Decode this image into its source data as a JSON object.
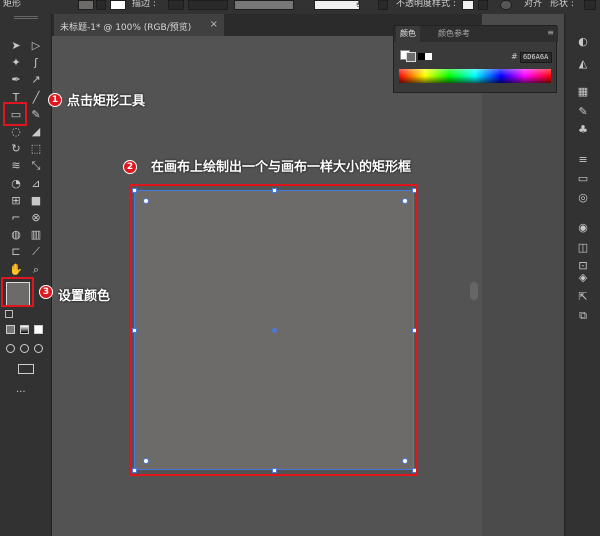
{
  "app": {
    "corner_label": "矩形"
  },
  "control_bar": {
    "stroke_label": "描边 :",
    "profile_label": "基本",
    "opacity_label": "不透明度",
    "style_label": "样式 :",
    "align_label": "对齐",
    "shape_label": "形状 :"
  },
  "document": {
    "tab_title": "未标题-1* @ 100% (RGB/预览)",
    "close": "×"
  },
  "color_panel": {
    "tab_color": "颜色",
    "tab_guide": "颜色参考",
    "hex_symbol": "#",
    "hex_value": "6D6A6A",
    "fill_hex": "#6d6a6a"
  },
  "annotations": {
    "step1": {
      "number": "1",
      "text": "点击矩形工具"
    },
    "step2": {
      "number": "2",
      "text": "在画布上绘制出一个与画布一样大小的矩形框"
    },
    "step3": {
      "number": "3",
      "text": "设置颜色"
    }
  },
  "toolbar": {
    "tools": [
      "selection-tool",
      "direct-selection-tool",
      "magic-wand-tool",
      "lasso-tool",
      "pen-tool",
      "curvature-tool",
      "type-tool",
      "line-tool",
      "rectangle-tool",
      "paintbrush-tool",
      "shaper-tool",
      "eraser-tool",
      "rotate-tool",
      "scale-tool",
      "width-tool",
      "free-transform-tool",
      "shape-builder-tool",
      "perspective-grid-tool",
      "mesh-tool",
      "gradient-tool",
      "eyedropper-tool",
      "blend-tool",
      "symbol-sprayer-tool",
      "column-graph-tool",
      "artboard-tool",
      "slice-tool",
      "hand-tool",
      "zoom-tool"
    ],
    "more": "..."
  },
  "accent_red": "#e0161e",
  "selection_blue": "#4a7bd8"
}
